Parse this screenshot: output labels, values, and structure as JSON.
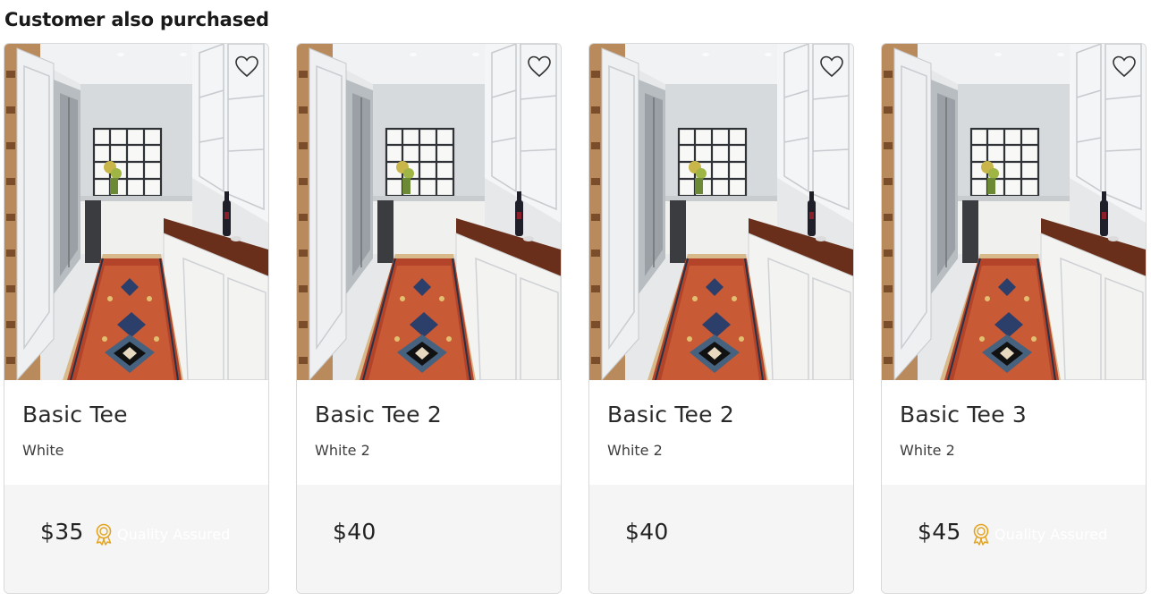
{
  "section": {
    "title": "Customer also purchased"
  },
  "colors": {
    "quality_icon": "#e3a422",
    "footer_bg": "#f5f5f5",
    "border": "#d9d9d9"
  },
  "products": [
    {
      "name": "Basic Tee",
      "color": "White",
      "price": "$35",
      "quality_label": "Quality Assured",
      "has_quality": true,
      "image_icon": "kitchen-photo",
      "wishlist_icon": "heart-outline-icon"
    },
    {
      "name": "Basic Tee 2",
      "color": "White 2",
      "price": "$40",
      "quality_label": "",
      "has_quality": false,
      "image_icon": "kitchen-photo",
      "wishlist_icon": "heart-outline-icon"
    },
    {
      "name": "Basic Tee 2",
      "color": "White 2",
      "price": "$40",
      "quality_label": "",
      "has_quality": false,
      "image_icon": "kitchen-photo",
      "wishlist_icon": "heart-outline-icon"
    },
    {
      "name": "Basic Tee 3",
      "color": "White 2",
      "price": "$45",
      "quality_label": "Quality Assured",
      "has_quality": true,
      "image_icon": "kitchen-photo",
      "wishlist_icon": "heart-outline-icon"
    }
  ]
}
